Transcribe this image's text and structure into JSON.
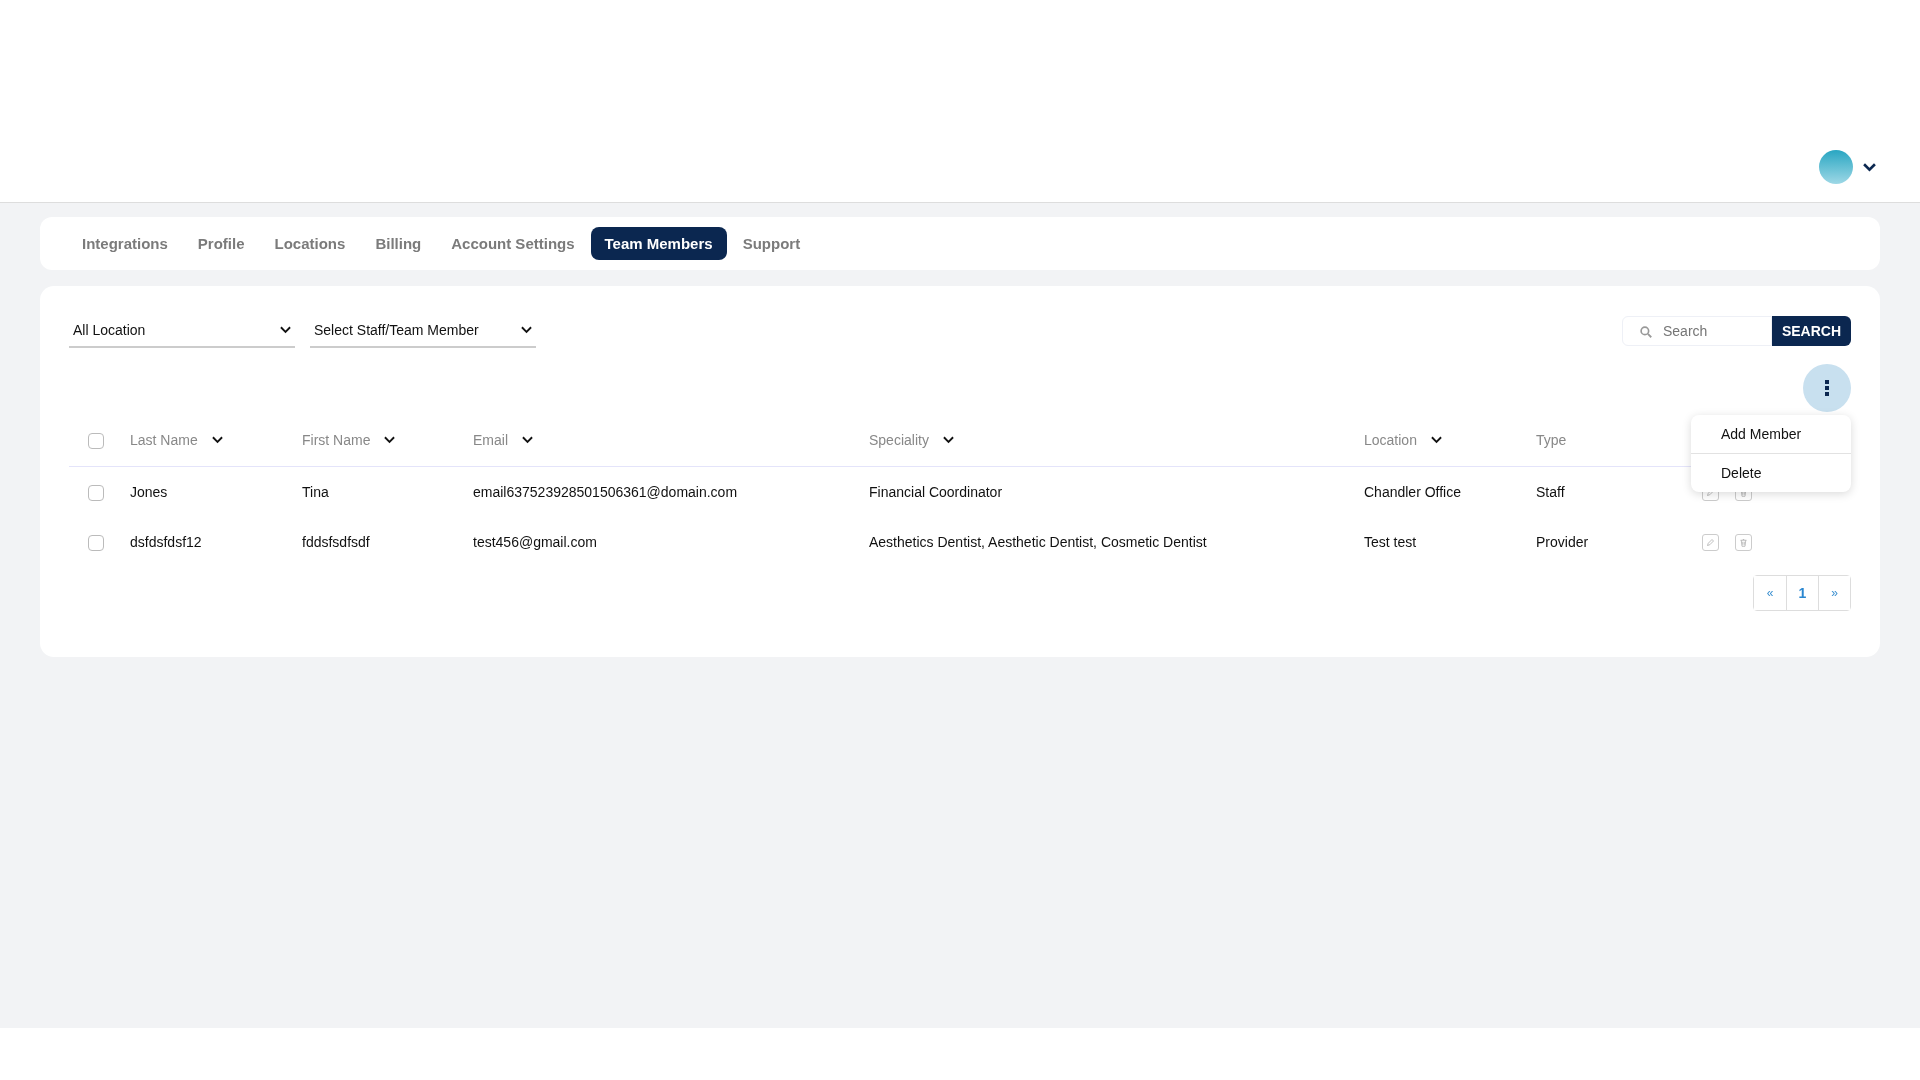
{
  "tabs": [
    {
      "label": "Integrations",
      "selected": false
    },
    {
      "label": "Profile",
      "selected": false
    },
    {
      "label": "Locations",
      "selected": false
    },
    {
      "label": "Billing",
      "selected": false
    },
    {
      "label": "Account Settings",
      "selected": false
    },
    {
      "label": "Team Members",
      "selected": true
    },
    {
      "label": "Support",
      "selected": false
    }
  ],
  "filters": [
    {
      "value": "All Location"
    },
    {
      "value": "Select Staff/Team Member"
    }
  ],
  "search": {
    "placeholder": "Search",
    "button": "SEARCH"
  },
  "menu": {
    "items": [
      "Add Member",
      "Delete"
    ]
  },
  "table": {
    "select_all": {
      "checked": false
    },
    "columns": [
      {
        "label": "Last Name",
        "sortable": true
      },
      {
        "label": "First Name",
        "sortable": true
      },
      {
        "label": "Email",
        "sortable": true
      },
      {
        "label": "Speciality",
        "sortable": true
      },
      {
        "label": "Location",
        "sortable": true
      },
      {
        "label": "Type",
        "sortable": false
      }
    ],
    "rows": [
      {
        "checked": false,
        "cells": [
          "Jones",
          "Tina",
          "email637523928501506361@domain.com",
          "Financial Coordinator",
          "Chandler Office",
          "Staff"
        ]
      },
      {
        "checked": false,
        "cells": [
          "dsfdsfdsf12",
          "fddsfsdfsdf",
          "test456@gmail.com",
          "Aesthetics Dentist, Aesthetic Dentist, Cosmetic Dentist",
          "Test test",
          "Provider"
        ]
      }
    ]
  },
  "pagination": {
    "prev": "«",
    "pages": [
      {
        "label": "1",
        "selected": true
      }
    ],
    "next": "»"
  }
}
